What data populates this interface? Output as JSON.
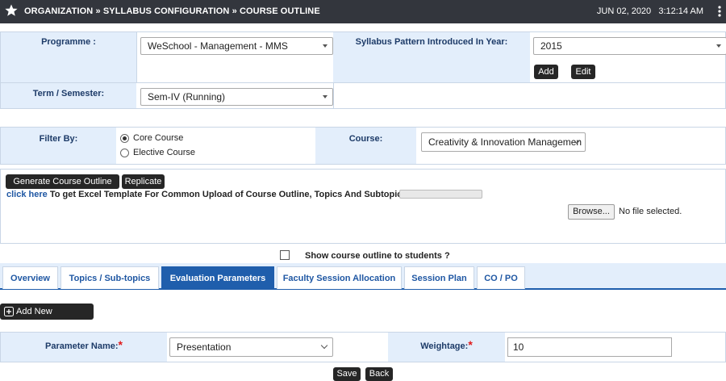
{
  "topbar": {
    "breadcrumb": "ORGANIZATION » SYLLABUS CONFIGURATION » COURSE OUTLINE",
    "date": "JUN 02, 2020",
    "time": "3:12:14 AM"
  },
  "programme": {
    "label": "Programme :",
    "value": "WeSchool - Management - MMS"
  },
  "pattern": {
    "label": "Syllabus Pattern Introduced In Year:",
    "value": "2015",
    "add_label": "Add",
    "edit_label": "Edit"
  },
  "term": {
    "label": "Term / Semester:",
    "value": "Sem-IV (Running)"
  },
  "filter": {
    "label": "Filter By:",
    "options": [
      "Core Course",
      "Elective Course"
    ],
    "selected": "Core Course"
  },
  "course": {
    "label": "Course:",
    "value": "Creativity & Innovation Managemen"
  },
  "actions": {
    "generate_label": "Generate Course Outline PDF",
    "replicate_label": "Replicate"
  },
  "upload": {
    "link_text": "click here",
    "description": "To get Excel Template For Common Upload of Course Outline, Topics And Subtopics.",
    "browse_label": "Browse...",
    "file_status": "No file selected."
  },
  "show_outline": {
    "label": "Show course outline to students ?",
    "checked": false
  },
  "tabs": [
    "Overview",
    "Topics / Sub-topics",
    "Evaluation Parameters",
    "Faculty Session Allocation",
    "Session Plan",
    "CO / PO"
  ],
  "active_tab": "Evaluation Parameters",
  "parameters": {
    "add_label": "Add New Parameter",
    "name_label": "Parameter Name:",
    "name_value": "Presentation",
    "weightage_label": "Weightage:",
    "weightage_value": "10",
    "required_mark": "*"
  },
  "footer": {
    "save_label": "Save",
    "back_label": "Back"
  },
  "colors": {
    "topbar": "#33363d",
    "label_bg": "#e3eefb",
    "active_tab": "#1f5eac",
    "required": "#e01b1b"
  }
}
